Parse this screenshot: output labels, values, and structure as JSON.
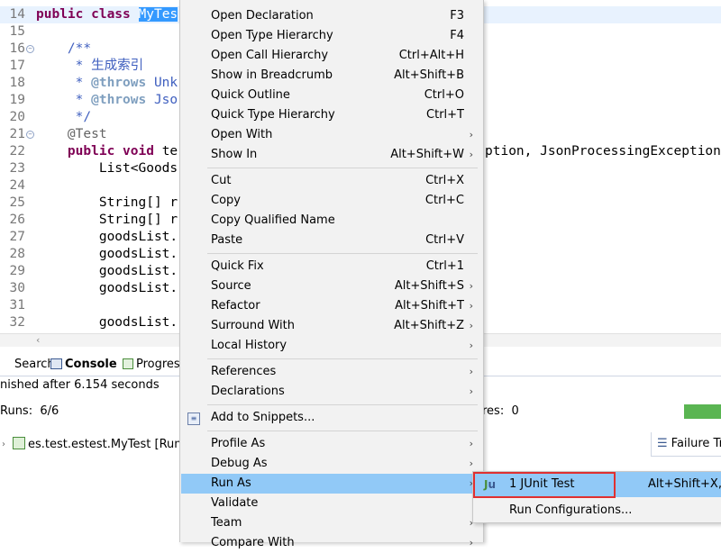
{
  "editor": {
    "lines": [
      {
        "num": "14",
        "parts": [
          {
            "t": "kw",
            "v": "public class "
          },
          {
            "t": "sel",
            "v": "MyTes"
          }
        ],
        "current": true
      },
      {
        "num": "15",
        "parts": []
      },
      {
        "num": "16",
        "fold": true,
        "parts": [
          {
            "t": "cm",
            "v": "    /**"
          }
        ]
      },
      {
        "num": "17",
        "parts": [
          {
            "t": "cm",
            "v": "     * 生成索引"
          }
        ]
      },
      {
        "num": "18",
        "parts": [
          {
            "t": "cm",
            "v": "     * "
          },
          {
            "t": "tag",
            "v": "@throws"
          },
          {
            "t": "cm",
            "v": " Unk"
          }
        ]
      },
      {
        "num": "19",
        "parts": [
          {
            "t": "cm",
            "v": "     * "
          },
          {
            "t": "tag",
            "v": "@throws"
          },
          {
            "t": "cm",
            "v": " Jso"
          }
        ]
      },
      {
        "num": "20",
        "parts": [
          {
            "t": "cm",
            "v": "     */"
          }
        ]
      },
      {
        "num": "21",
        "fold": true,
        "parts": [
          {
            "t": "ann",
            "v": "    @Test"
          }
        ]
      },
      {
        "num": "22",
        "parts": [
          {
            "t": "kw",
            "v": "    public void "
          },
          {
            "t": "",
            "v": "te"
          }
        ]
      },
      {
        "num": "23",
        "parts": [
          {
            "t": "",
            "v": "        List<Goods"
          }
        ]
      },
      {
        "num": "24",
        "parts": []
      },
      {
        "num": "25",
        "parts": [
          {
            "t": "",
            "v": "        String[] r"
          }
        ]
      },
      {
        "num": "26",
        "parts": [
          {
            "t": "",
            "v": "        String[] r"
          }
        ]
      },
      {
        "num": "27",
        "parts": [
          {
            "t": "",
            "v": "        goodsList."
          }
        ]
      },
      {
        "num": "28",
        "parts": [
          {
            "t": "",
            "v": "        goodsList."
          }
        ]
      },
      {
        "num": "29",
        "parts": [
          {
            "t": "",
            "v": "        goodsList."
          }
        ]
      },
      {
        "num": "30",
        "parts": [
          {
            "t": "",
            "v": "        goodsList."
          }
        ]
      },
      {
        "num": "31",
        "parts": []
      },
      {
        "num": "32",
        "parts": [
          {
            "t": "",
            "v": "        goodsList."
          }
        ]
      }
    ],
    "line22_tail": "ption, JsonProcessingException"
  },
  "panel": {
    "tabs": [
      {
        "label": "Search",
        "icon": "search-icon"
      },
      {
        "label": "Console",
        "icon": "console-icon",
        "active": true
      },
      {
        "label": "Progres",
        "icon": "progress-icon"
      }
    ],
    "status": "nished after 6.154 seconds",
    "runs_label": "Runs:",
    "runs_value": "6/6",
    "failures_label": "res:",
    "failures_value": "0",
    "tree_item": "es.test.estest.MyTest [Runner",
    "failure_trace": "Failure Tr",
    "progress_color": "#5ab552"
  },
  "menu": {
    "items": [
      {
        "label": "Open Declaration",
        "shortcut": "F3"
      },
      {
        "label": "Open Type Hierarchy",
        "shortcut": "F4"
      },
      {
        "label": "Open Call Hierarchy",
        "shortcut": "Ctrl+Alt+H"
      },
      {
        "label": "Show in Breadcrumb",
        "shortcut": "Alt+Shift+B"
      },
      {
        "label": "Quick Outline",
        "shortcut": "Ctrl+O"
      },
      {
        "label": "Quick Type Hierarchy",
        "shortcut": "Ctrl+T"
      },
      {
        "label": "Open With",
        "shortcut": "",
        "submenu": true
      },
      {
        "label": "Show In",
        "shortcut": "Alt+Shift+W",
        "submenu": true
      },
      {
        "sep": true
      },
      {
        "label": "Cut",
        "shortcut": "Ctrl+X"
      },
      {
        "label": "Copy",
        "shortcut": "Ctrl+C"
      },
      {
        "label": "Copy Qualified Name",
        "shortcut": ""
      },
      {
        "label": "Paste",
        "shortcut": "Ctrl+V"
      },
      {
        "sep": true
      },
      {
        "label": "Quick Fix",
        "shortcut": "Ctrl+1"
      },
      {
        "label": "Source",
        "shortcut": "Alt+Shift+S",
        "submenu": true
      },
      {
        "label": "Refactor",
        "shortcut": "Alt+Shift+T",
        "submenu": true
      },
      {
        "label": "Surround With",
        "shortcut": "Alt+Shift+Z",
        "submenu": true
      },
      {
        "label": "Local History",
        "shortcut": "",
        "submenu": true
      },
      {
        "sep": true
      },
      {
        "label": "References",
        "shortcut": "",
        "submenu": true
      },
      {
        "label": "Declarations",
        "shortcut": "",
        "submenu": true
      },
      {
        "sep": true
      },
      {
        "label": "Add to Snippets...",
        "shortcut": "",
        "icon": "snippet-icon"
      },
      {
        "sep": true
      },
      {
        "label": "Profile As",
        "shortcut": "",
        "submenu": true
      },
      {
        "label": "Debug As",
        "shortcut": "",
        "submenu": true
      },
      {
        "label": "Run As",
        "shortcut": "",
        "submenu": true,
        "highlighted": true
      },
      {
        "label": "Validate",
        "shortcut": ""
      },
      {
        "label": "Team",
        "shortcut": "",
        "submenu": true
      },
      {
        "label": "Compare With",
        "shortcut": "",
        "submenu": true
      }
    ]
  },
  "submenu": {
    "items": [
      {
        "label": "1 JUnit Test",
        "shortcut": "Alt+Shift+X, T",
        "icon": "junit-icon",
        "highlighted": true
      },
      {
        "label": "Run Configurations...",
        "shortcut": ""
      }
    ],
    "highlight_color": "#e03030"
  }
}
